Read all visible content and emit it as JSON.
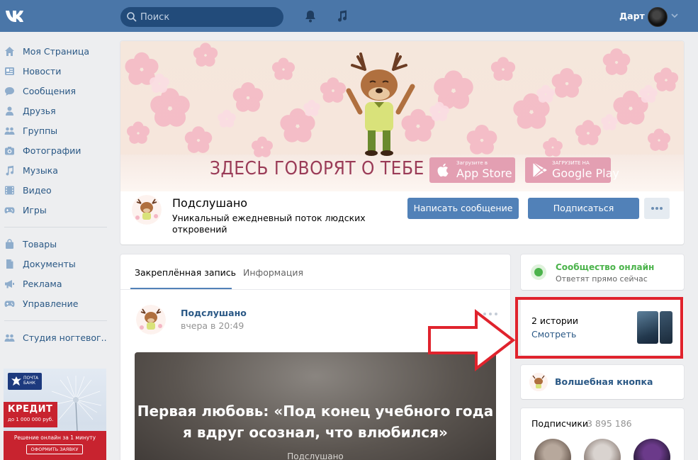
{
  "header": {
    "search_placeholder": "Поиск",
    "user_name": "Дарт"
  },
  "menu": {
    "items": [
      {
        "label": "Моя Страница",
        "icon": "home-icon"
      },
      {
        "label": "Новости",
        "icon": "news-icon"
      },
      {
        "label": "Сообщения",
        "icon": "message-icon"
      },
      {
        "label": "Друзья",
        "icon": "friends-icon"
      },
      {
        "label": "Группы",
        "icon": "groups-icon"
      },
      {
        "label": "Фотографии",
        "icon": "camera-icon"
      },
      {
        "label": "Музыка",
        "icon": "music-icon"
      },
      {
        "label": "Видео",
        "icon": "video-icon"
      },
      {
        "label": "Игры",
        "icon": "gamepad-icon"
      }
    ],
    "items2": [
      {
        "label": "Товары",
        "icon": "bag-icon"
      },
      {
        "label": "Документы",
        "icon": "document-icon"
      },
      {
        "label": "Реклама",
        "icon": "megaphone-icon"
      },
      {
        "label": "Управление",
        "icon": "gamepad-icon"
      }
    ],
    "items3": [
      {
        "label": "Студия ногтевог..",
        "icon": "groups-icon"
      }
    ]
  },
  "ad": {
    "logo_text": "ПОЧТА БАНК",
    "credit": "КРЕДИТ",
    "amount": "до 1 000 000 руб.",
    "tagline": "Решение онлайн за 1 минуту",
    "button": "ОФОРМИТЬ ЗАЯВКУ"
  },
  "cover": {
    "headline": "ЗДЕСЬ ГОВОРЯТ О ТЕБЕ",
    "appstore_small": "Загрузите в",
    "appstore_big": "App Store",
    "googleplay_small": "ЗАГРУЗИТЕ НА",
    "googleplay_big": "Google Play"
  },
  "group": {
    "name": "Подслушано",
    "status": "Уникальный ежедневный поток людских откровений",
    "write_button": "Написать сообщение",
    "subscribe_button": "Подписаться"
  },
  "wall": {
    "tab_pinned": "Закреплённая запись",
    "tab_info": "Информация",
    "post_author": "Подслушано",
    "post_time": "вчера в 20:49",
    "post_title": "Первая любовь: «Под конец учебного года я вдруг осознал, что влюбился»",
    "post_source": "Подслушано"
  },
  "sidebar": {
    "online_title": "Сообщество онлайн",
    "online_sub": "Ответят прямо сейчас",
    "stories_title": "2 истории",
    "stories_link": "Смотреть",
    "magic_button": "Волшебная кнопка",
    "subscribers_title": "Подписчики",
    "subscribers_count": "3 895 186"
  },
  "colors": {
    "header_bg": "#4a76a8",
    "link": "#2a5885",
    "button_primary": "#5181b8",
    "online_green": "#4bb34b",
    "highlight_red": "#e0232d"
  }
}
